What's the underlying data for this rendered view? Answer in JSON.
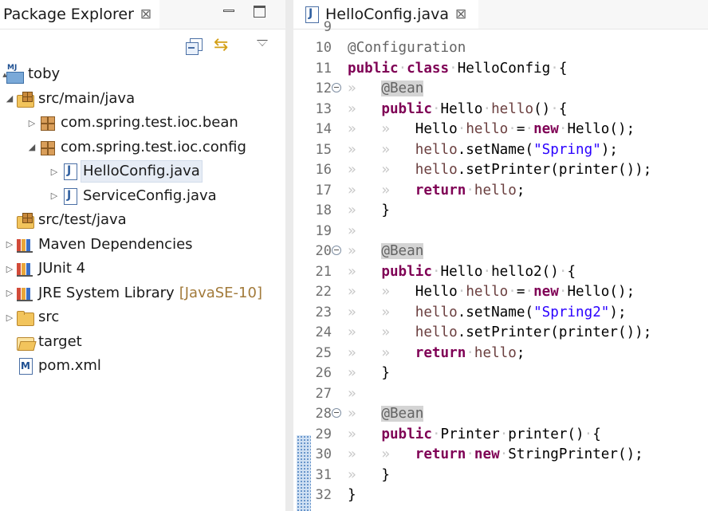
{
  "explorer": {
    "tab_title": "Package Explorer",
    "close_glyph": "⊠",
    "icons": [
      "collapse-all-icon",
      "link-with-editor-icon",
      "view-menu-icon",
      "minimize-icon",
      "maximize-icon"
    ],
    "tree": [
      {
        "label": "toby",
        "icon": "project-icon",
        "arrow": "▴"
      },
      {
        "label": "src/main/java",
        "icon": "source-folder-icon",
        "arrow": "◢"
      },
      {
        "label": "com.spring.test.ioc.bean",
        "icon": "package-icon",
        "arrow": "▷"
      },
      {
        "label": "com.spring.test.ioc.config",
        "icon": "package-icon",
        "arrow": "◢"
      },
      {
        "label": "HelloConfig.java",
        "icon": "java-file-icon",
        "arrow": "▷",
        "selected": true
      },
      {
        "label": "ServiceConfig.java",
        "icon": "java-file-icon",
        "arrow": "▷"
      },
      {
        "label": "src/test/java",
        "icon": "source-folder-icon",
        "arrow": ""
      },
      {
        "label": "Maven Dependencies",
        "icon": "library-icon",
        "arrow": "▷"
      },
      {
        "label": "JUnit 4",
        "icon": "library-icon",
        "arrow": "▷"
      },
      {
        "label": "JRE System Library",
        "decoration": "[JavaSE-10]",
        "icon": "library-icon",
        "arrow": "▷"
      },
      {
        "label": "src",
        "icon": "folder-icon",
        "arrow": "▷"
      },
      {
        "label": "target",
        "icon": "folder-open-icon",
        "arrow": ""
      },
      {
        "label": "pom.xml",
        "icon": "pom-file-icon",
        "arrow": ""
      }
    ]
  },
  "editor": {
    "tab_title": "HelloConfig.java",
    "close_glyph": "⊠",
    "partial_line": "9",
    "lines": [
      {
        "num": "10",
        "text": "@Configuration"
      },
      {
        "num": "11",
        "text": "public class HelloConfig {"
      },
      {
        "num": "12",
        "text": "@Bean",
        "fold": true
      },
      {
        "num": "13",
        "text": "public Hello hello() {"
      },
      {
        "num": "14",
        "text": "Hello hello = new Hello();"
      },
      {
        "num": "15",
        "text": "hello.setName(\"Spring\");"
      },
      {
        "num": "16",
        "text": "hello.setPrinter(printer());"
      },
      {
        "num": "17",
        "text": "return hello;"
      },
      {
        "num": "18",
        "text": "}"
      },
      {
        "num": "19",
        "text": ""
      },
      {
        "num": "20",
        "text": "@Bean",
        "fold": true
      },
      {
        "num": "21",
        "text": "public Hello hello2() {"
      },
      {
        "num": "22",
        "text": "Hello hello = new Hello();"
      },
      {
        "num": "23",
        "text": "hello.setName(\"Spring2\");"
      },
      {
        "num": "24",
        "text": "hello.setPrinter(printer());"
      },
      {
        "num": "25",
        "text": "return hello;"
      },
      {
        "num": "26",
        "text": "}"
      },
      {
        "num": "27",
        "text": ""
      },
      {
        "num": "28",
        "text": "@Bean",
        "fold": true
      },
      {
        "num": "29",
        "text": "public Printer printer() {"
      },
      {
        "num": "30",
        "text": "return new StringPrinter();"
      },
      {
        "num": "31",
        "text": "}"
      },
      {
        "num": "32",
        "text": "}"
      }
    ]
  },
  "colors": {
    "keyword": "#7f0055",
    "annotation": "#646464",
    "string": "#2a00ff",
    "local_variable": "#6a3e3e",
    "selection": "#e6ecf5"
  }
}
